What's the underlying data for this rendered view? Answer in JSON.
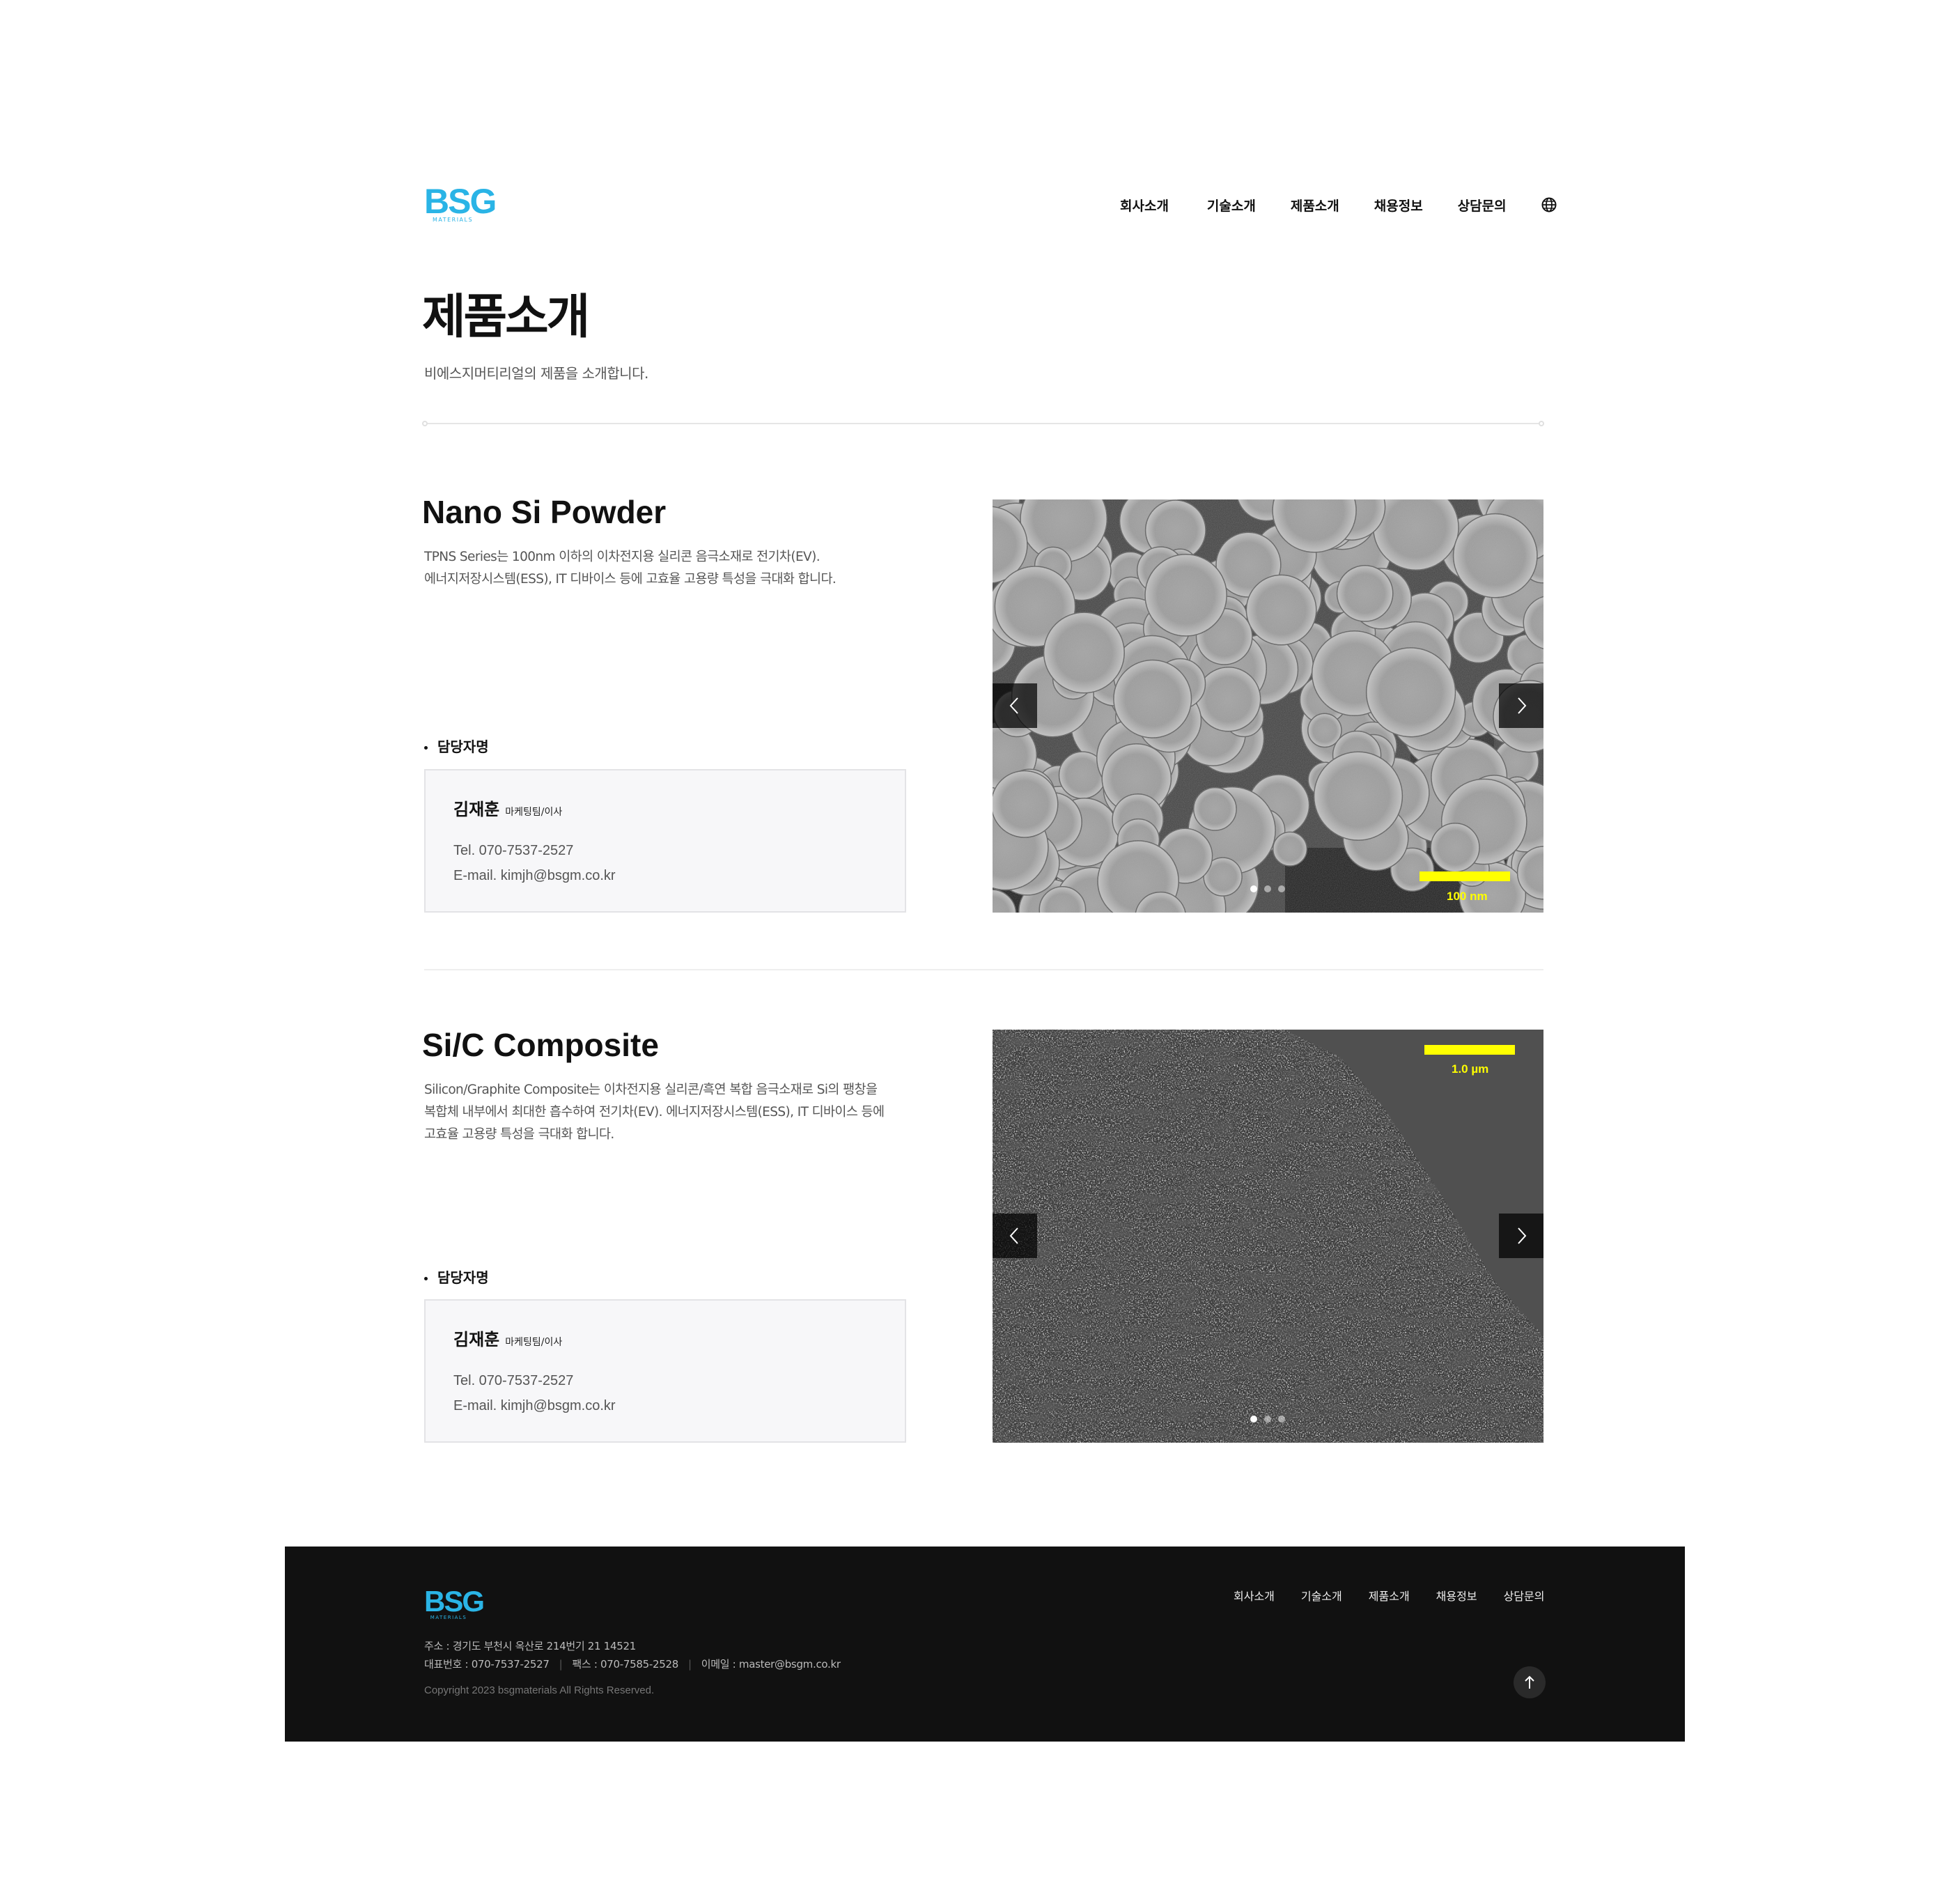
{
  "header": {
    "logo_text": "BSG",
    "logo_sub": "MATERIALS",
    "nav": [
      "회사소개",
      "기술소개",
      "제품소개",
      "채용정보",
      "상담문의"
    ],
    "lang_icon": "globe-icon"
  },
  "page": {
    "title": "제품소개",
    "subtitle": "비에스지머티리얼의 제품을 소개합니다."
  },
  "products": [
    {
      "title": "Nano Si Powder",
      "desc": [
        "TPNS Series는 100nm 이하의 이차전지용 실리콘 음극소재로 전기차(EV).",
        "에너지저장시스템(ESS), IT 디바이스 등에 고효율 고용량 특성을 극대화 합니다."
      ],
      "contact_label": "담당자명",
      "contact": {
        "name": "김재훈",
        "role": "마케팅팀/이사",
        "tel": "Tel. 070-7537-2527",
        "email": "E-mail. kimjh@bsgm.co.kr"
      },
      "image": {
        "scale_label": "100 nm",
        "slides": 3,
        "active": 0
      }
    },
    {
      "title": "Si/C Composite",
      "desc": [
        "Silicon/Graphite Composite는 이차전지용 실리콘/흑연 복합 음극소재로 Si의 팽창을",
        "복합체 내부에서 최대한 흡수하여 전기차(EV). 에너지저장시스템(ESS), IT 디바이스 등에",
        "고효율 고용량 특성을 극대화 합니다."
      ],
      "contact_label": "담당자명",
      "contact": {
        "name": "김재훈",
        "role": "마케팅팀/이사",
        "tel": "Tel. 070-7537-2527",
        "email": "E-mail. kimjh@bsgm.co.kr"
      },
      "image": {
        "scale_label": "1.0 µm",
        "slides": 3,
        "active": 0
      }
    }
  ],
  "footer": {
    "logo_text": "BSG",
    "logo_sub": "MATERIALS",
    "nav": [
      "회사소개",
      "기술소개",
      "제품소개",
      "채용정보",
      "상담문의"
    ],
    "address": "주소 : 경기도 부천시 옥산로 214번기 21 14521",
    "phone": "대표번호 : 070-7537-2527",
    "fax": "팩스 : 070-7585-2528",
    "email": "이메일 : master@bsgm.co.kr",
    "copyright": "Copyright 2023 bsgmaterials All Rights Reserved."
  },
  "colors": {
    "brand": "#2ab4e6",
    "footer_bg": "#111111",
    "scale_bar": "#ffff00"
  }
}
